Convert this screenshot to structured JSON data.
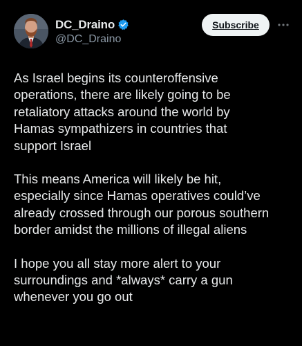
{
  "author": {
    "display_name": "DC_Draino",
    "handle": "@DC_Draino",
    "verified": true
  },
  "actions": {
    "subscribe_label": "Subscribe",
    "more_icon": "more-horizontal-icon"
  },
  "tweet": {
    "paragraphs": [
      "As Israel begins its counteroffensive\noperations, there are likely going to be\nretaliatory attacks around the world by\nHamas sympathizers in countries that\nsupport Israel",
      "This means America will likely be hit,\nespecially since Hamas operatives could’ve\nalready crossed through our porous southern\nborder amidst the millions of illegal aliens",
      "I hope you all stay more alert to your\nsurroundings and *always* carry a gun\nwhenever you go out"
    ]
  },
  "colors": {
    "background": "#000000",
    "text": "#e7e9ea",
    "secondary_text": "#8b98a5",
    "verified_blue": "#1d9bf0",
    "button_bg": "#eff3f4"
  }
}
